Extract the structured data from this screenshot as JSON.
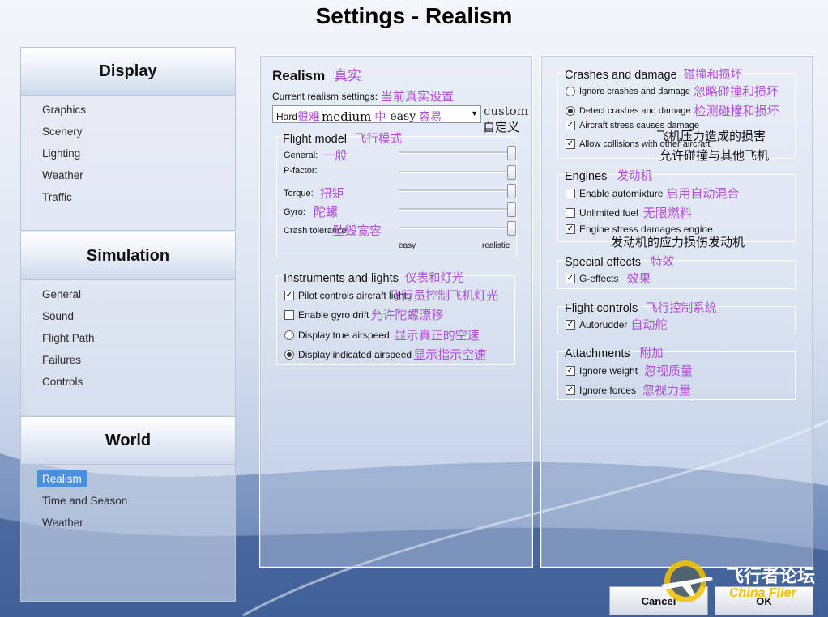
{
  "window": {
    "title": "Settings - Realism"
  },
  "nav": [
    {
      "header": "Display",
      "items": [
        "Graphics",
        "Scenery",
        "Lighting",
        "Weather",
        "Traffic"
      ]
    },
    {
      "header": "Simulation",
      "items": [
        "General",
        "Sound",
        "Flight Path",
        "Failures",
        "Controls"
      ]
    },
    {
      "header": "World",
      "items": [
        "Realism",
        "Time and Season",
        "Weather"
      ],
      "selected": "Realism"
    }
  ],
  "realism": {
    "title": "Realism",
    "title_cn": "真实",
    "current_label": "Current realism settings:",
    "current_label_cn": "当前真实设置",
    "preset_value": "Hard",
    "preset_value_cn": "很难",
    "preset_options": {
      "medium": "medium",
      "medium_cn": "中",
      "easy": "easy",
      "easy_cn": "容易",
      "custom": "custom",
      "custom_cn": "自定义"
    },
    "flight_model": {
      "title": "Flight model",
      "title_cn": "飞行模式",
      "rows": [
        {
          "label": "General:",
          "cn": "一般",
          "level": 1.0
        },
        {
          "label": "P-factor:",
          "cn": "",
          "level": 1.0
        },
        {
          "label": "Torque:",
          "cn": "扭矩",
          "level": 1.0
        },
        {
          "label": "Gyro:",
          "cn": "陀螺",
          "level": 1.0
        },
        {
          "label": "Crash tolerance:",
          "cn": "坠毁宽容",
          "level": 1.0
        }
      ],
      "scale_left": "easy",
      "scale_right": "realistic"
    },
    "instruments": {
      "title": "Instruments and lights",
      "title_cn": "仪表和灯光",
      "items": [
        {
          "type": "checkbox",
          "checked": true,
          "label": "Pilot controls aircraft lights",
          "cn": "飞行员控制飞机灯光"
        },
        {
          "type": "checkbox",
          "checked": false,
          "label": "Enable gyro drift",
          "cn": "允许陀螺漂移"
        },
        {
          "type": "radio",
          "checked": false,
          "label": "Display true airspeed",
          "cn": "显示真正的空速"
        },
        {
          "type": "radio",
          "checked": true,
          "label": "Display indicated airspeed",
          "cn": "显示指示空速"
        }
      ]
    }
  },
  "right": {
    "crashes": {
      "title": "Crashes and damage",
      "title_cn": "碰撞和损坏",
      "items": [
        {
          "type": "radio",
          "checked": false,
          "label": "Ignore crashes and damage",
          "cn": "忽略碰撞和损坏"
        },
        {
          "type": "radio",
          "checked": true,
          "label": "Detect crashes and damage",
          "cn": "检测碰撞和损坏"
        },
        {
          "type": "checkbox",
          "checked": true,
          "label": "Aircraft stress causes damage",
          "cn": "飞机压力造成的损害"
        },
        {
          "type": "checkbox",
          "checked": true,
          "label": "Allow collisions with other aircraft",
          "cn": "允许碰撞与其他飞机"
        }
      ]
    },
    "engines": {
      "title": "Engines",
      "title_cn": "发动机",
      "items": [
        {
          "type": "checkbox",
          "checked": false,
          "label": "Enable automixture",
          "cn": "启用自动混合"
        },
        {
          "type": "checkbox",
          "checked": false,
          "label": "Unlimited fuel",
          "cn": "无限燃料"
        },
        {
          "type": "checkbox",
          "checked": true,
          "label": "Engine stress damages engine",
          "cn": "发动机的应力损伤发动机"
        }
      ]
    },
    "effects": {
      "title": "Special effects",
      "title_cn": "特效",
      "items": [
        {
          "type": "checkbox",
          "checked": true,
          "label": "G-effects",
          "cn": "效果"
        }
      ]
    },
    "flight_controls": {
      "title": "Flight controls",
      "title_cn": "飞行控制系统",
      "items": [
        {
          "type": "checkbox",
          "checked": true,
          "label": "Autorudder",
          "cn": "自动舵"
        }
      ]
    },
    "attachments": {
      "title": "Attachments",
      "title_cn": "附加",
      "items": [
        {
          "type": "checkbox",
          "checked": true,
          "label": "Ignore weight",
          "cn": "忽视质量"
        },
        {
          "type": "checkbox",
          "checked": true,
          "label": "Ignore forces",
          "cn": "忽视力量"
        }
      ]
    }
  },
  "buttons": {
    "cancel": "Cancel",
    "ok": "OK"
  },
  "watermark": {
    "cn": "飞行者论坛",
    "en": "China Flier"
  },
  "colors": {
    "accent": "#4a90e2",
    "annotation": "#b04fd8"
  }
}
